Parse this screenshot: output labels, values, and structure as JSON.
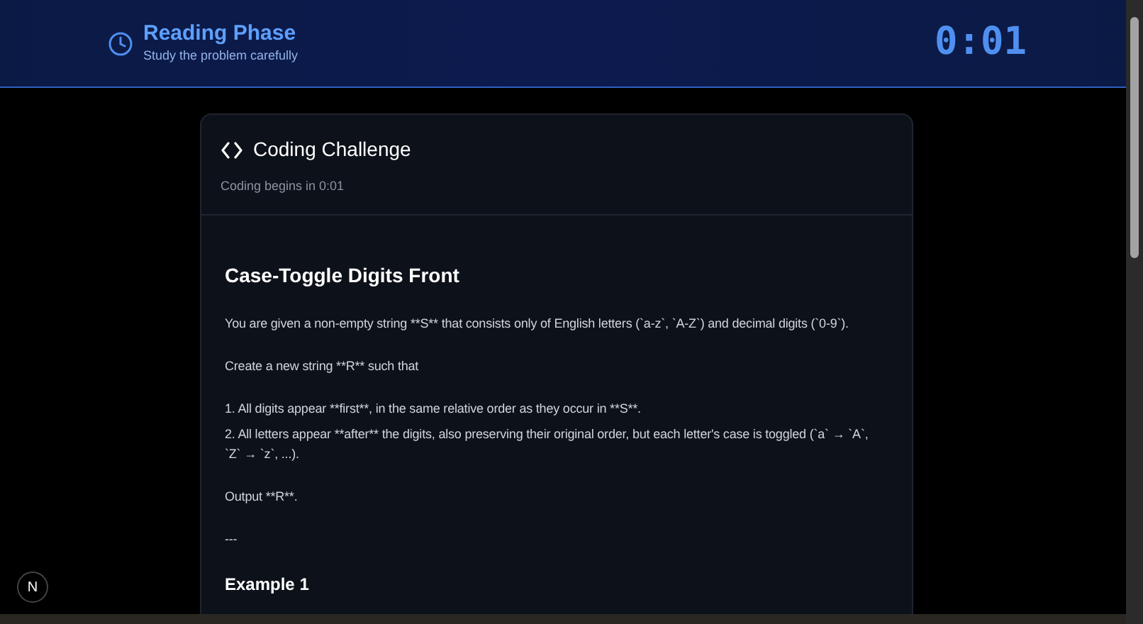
{
  "header": {
    "title": "Reading Phase",
    "subtitle": "Study the problem carefully",
    "timer": "0:01"
  },
  "card": {
    "title": "Coding Challenge",
    "subtitle": "Coding begins in 0:01"
  },
  "problem": {
    "title": "Case-Toggle Digits Front",
    "blocks": [
      {
        "kind": "paragraph",
        "text": "You are given a non-empty string **S** that consists only of English letters (`a-z`, `A-Z`) and decimal digits (`0-9`)."
      },
      {
        "kind": "paragraph",
        "text": "Create a new string **R** such that"
      },
      {
        "kind": "list",
        "items": [
          "1. All digits appear **first**, in the same relative order as they occur in **S**.",
          "2. All letters appear **after** the digits, also preserving their original order, but each letter's case is toggled (`a` → `A`, `Z` → `z`, ...)."
        ]
      },
      {
        "kind": "paragraph",
        "text": "Output **R**."
      },
      {
        "kind": "paragraph",
        "text": "---"
      },
      {
        "kind": "heading",
        "text": "Example 1"
      }
    ]
  },
  "dev_badge": "N"
}
